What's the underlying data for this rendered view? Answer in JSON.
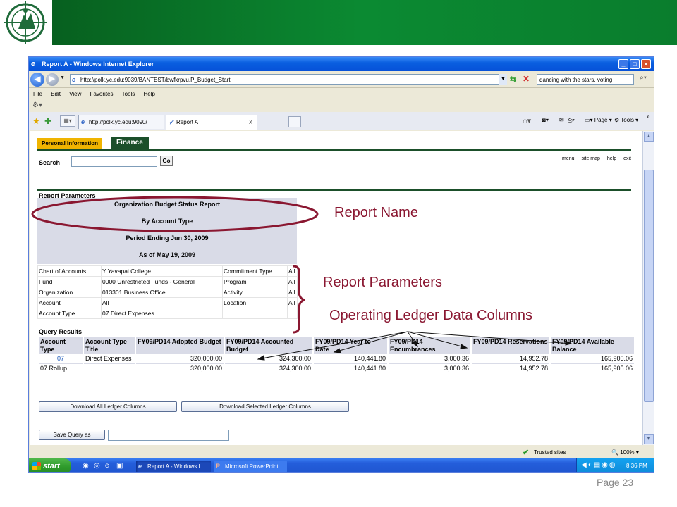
{
  "browser": {
    "window_title": "Report A - Windows Internet Explorer",
    "url": "http://polk.yc.edu:9039/BANTEST/bwfkrpvu.P_Budget_Start",
    "search_value": "dancing with the stars, voting",
    "menu": [
      "File",
      "Edit",
      "View",
      "Favorites",
      "Tools",
      "Help"
    ],
    "tabs": [
      {
        "label": "http://polk.yc.edu:9090/"
      },
      {
        "label": "Report A",
        "close": "x"
      }
    ],
    "commands": {
      "page": "Page",
      "tools": "Tools"
    },
    "status": {
      "trusted": "Trusted sites",
      "zoom": "100%"
    }
  },
  "page": {
    "nav_tabs": {
      "personal": "Personal Information",
      "finance": "Finance"
    },
    "search_label": "Search",
    "go_label": "Go",
    "util_links": [
      "menu",
      "site map",
      "help",
      "exit"
    ],
    "report_params_title": "Report Parameters",
    "report_header": {
      "line1": "Organization Budget Status Report",
      "line2": "By Account Type",
      "line3": "Period Ending Jun 30, 2009",
      "line4": "As of May 19, 2009"
    },
    "params": {
      "rows": [
        {
          "label": "Chart of Accounts",
          "value": "Y Yavapai College",
          "label2": "Commitment Type",
          "value2": "All"
        },
        {
          "label": "Fund",
          "value": "0000 Unrestricted Funds - General",
          "label2": "Program",
          "value2": "All"
        },
        {
          "label": "Organization",
          "value": "013301 Business Office",
          "label2": "Activity",
          "value2": "All"
        },
        {
          "label": "Account",
          "value": "All",
          "label2": "Location",
          "value2": "All"
        },
        {
          "label": "Account Type",
          "value": "07 Direct Expenses",
          "label2": "",
          "value2": ""
        }
      ]
    },
    "query_results_title": "Query Results",
    "query": {
      "headers": [
        "Account Type",
        "Account Type Title",
        "FY09/PD14 Adopted Budget",
        "FY09/PD14 Accounted Budget",
        "FY09/PD14 Year to Date",
        "FY09/PD14 Encumbrances",
        "FY09/PD14 Reservations",
        "FY09/PD14 Available Balance"
      ],
      "row1": [
        "07",
        "Direct Expenses",
        "320,000.00",
        "324,300.00",
        "140,441.80",
        "3,000.36",
        "14,952.78",
        "165,905.06"
      ],
      "rollup": [
        "07 Rollup",
        "",
        "320,000.00",
        "324,300.00",
        "140,441.80",
        "3,000.36",
        "14,952.78",
        "165,905.06"
      ]
    },
    "download_all": "Download All Ledger Columns",
    "download_selected": "Download Selected Ledger Columns",
    "save_query": "Save Query as"
  },
  "taskbar": {
    "start": "start",
    "items": [
      {
        "label": "Report A - Windows I..."
      },
      {
        "label": "Microsoft PowerPoint ..."
      }
    ],
    "time": "8:36 PM"
  },
  "annotations": {
    "report_name": "Report Name",
    "report_parameters": "Report Parameters",
    "ledger_columns": "Operating Ledger Data Columns",
    "color": "#8a1731"
  },
  "slide": {
    "page_number": "Page 23",
    "header_color": "#0b8a32"
  }
}
